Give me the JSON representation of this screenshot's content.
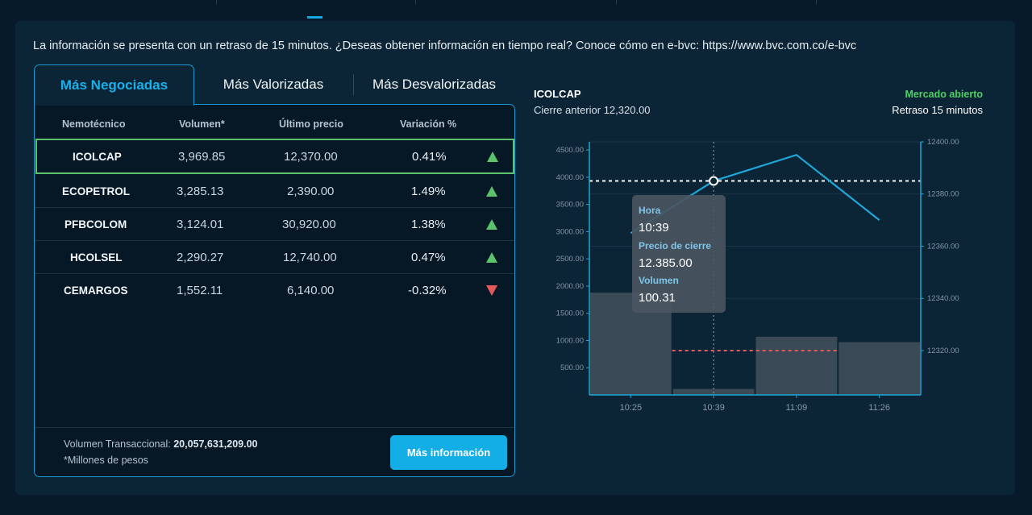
{
  "info_text": "La información se presenta con un retraso de 15 minutos. ¿Deseas obtener información en tiempo real? Conoce cómo en e-bvc: https://www.bvc.com.co/e-bvc",
  "tabs": [
    {
      "label": "Más Negociadas",
      "active": true
    },
    {
      "label": "Más Valorizadas",
      "active": false
    },
    {
      "label": "Más Desvalorizadas",
      "active": false
    }
  ],
  "table": {
    "headers": {
      "symbol": "Nemotécnico",
      "volume": "Volumen*",
      "last": "Último precio",
      "variation": "Variación %"
    },
    "rows": [
      {
        "symbol": "ICOLCAP",
        "volume": "3,969.85",
        "last": "12,370.00",
        "variation": "0.41%",
        "trend": "up"
      },
      {
        "symbol": "ECOPETROL",
        "volume": "3,285.13",
        "last": "2,390.00",
        "variation": "1.49%",
        "trend": "up"
      },
      {
        "symbol": "PFBCOLOM",
        "volume": "3,124.01",
        "last": "30,920.00",
        "variation": "1.38%",
        "trend": "up"
      },
      {
        "symbol": "HCOLSEL",
        "volume": "2,290.27",
        "last": "12,740.00",
        "variation": "0.47%",
        "trend": "up"
      },
      {
        "symbol": "CEMARGOS",
        "volume": "1,552.11",
        "last": "6,140.00",
        "variation": "-0.32%",
        "trend": "down"
      }
    ]
  },
  "footer": {
    "volume_label": "Volumen Transaccional:",
    "volume_value": "20,057,631,209.00",
    "note": "*Millones de pesos",
    "button": "Más información"
  },
  "chart_header": {
    "symbol": "ICOLCAP",
    "previous_close": "Cierre anterior 12,320.00",
    "status": "Mercado abierto",
    "delay": "Retraso 15 minutos"
  },
  "tooltip": {
    "hora_label": "Hora",
    "hora_value": "10:39",
    "precio_label": "Precio de cierre",
    "precio_value": "12.385.00",
    "volumen_label": "Volumen",
    "volumen_value": "100.31"
  },
  "colors": {
    "accent": "#15a8e0",
    "up": "#5cc36d",
    "down": "#e45a5a",
    "status_open": "#4fd064"
  },
  "chart_data": {
    "type": "bar",
    "categories": [
      "10:25",
      "10:39",
      "11:09",
      "11:26"
    ],
    "series": [
      {
        "values": [
          1880,
          110,
          1070,
          970
        ],
        "axis": "left"
      },
      {
        "values": [
          12365,
          12385,
          12395,
          12370
        ],
        "axis": "right"
      }
    ],
    "y_left_ticks": [
      "4500.00",
      "4000.00",
      "3500.00",
      "3000.00",
      "2500.00",
      "2000.00",
      "1500.00",
      "1000.00",
      "500.00"
    ],
    "y_left_range": [
      0,
      4650
    ],
    "y_right_ticks": [
      "12400.00",
      "12380.00",
      "12360.00",
      "12340.00",
      "12320.00"
    ],
    "y_right_range": [
      12303,
      12400
    ],
    "reference_lines": [
      {
        "value": 12385,
        "axis": "right",
        "color": "#ffffff"
      },
      {
        "value": 12320,
        "axis": "right",
        "color": "#e45a5a"
      }
    ],
    "highlight_category": "10:39"
  }
}
